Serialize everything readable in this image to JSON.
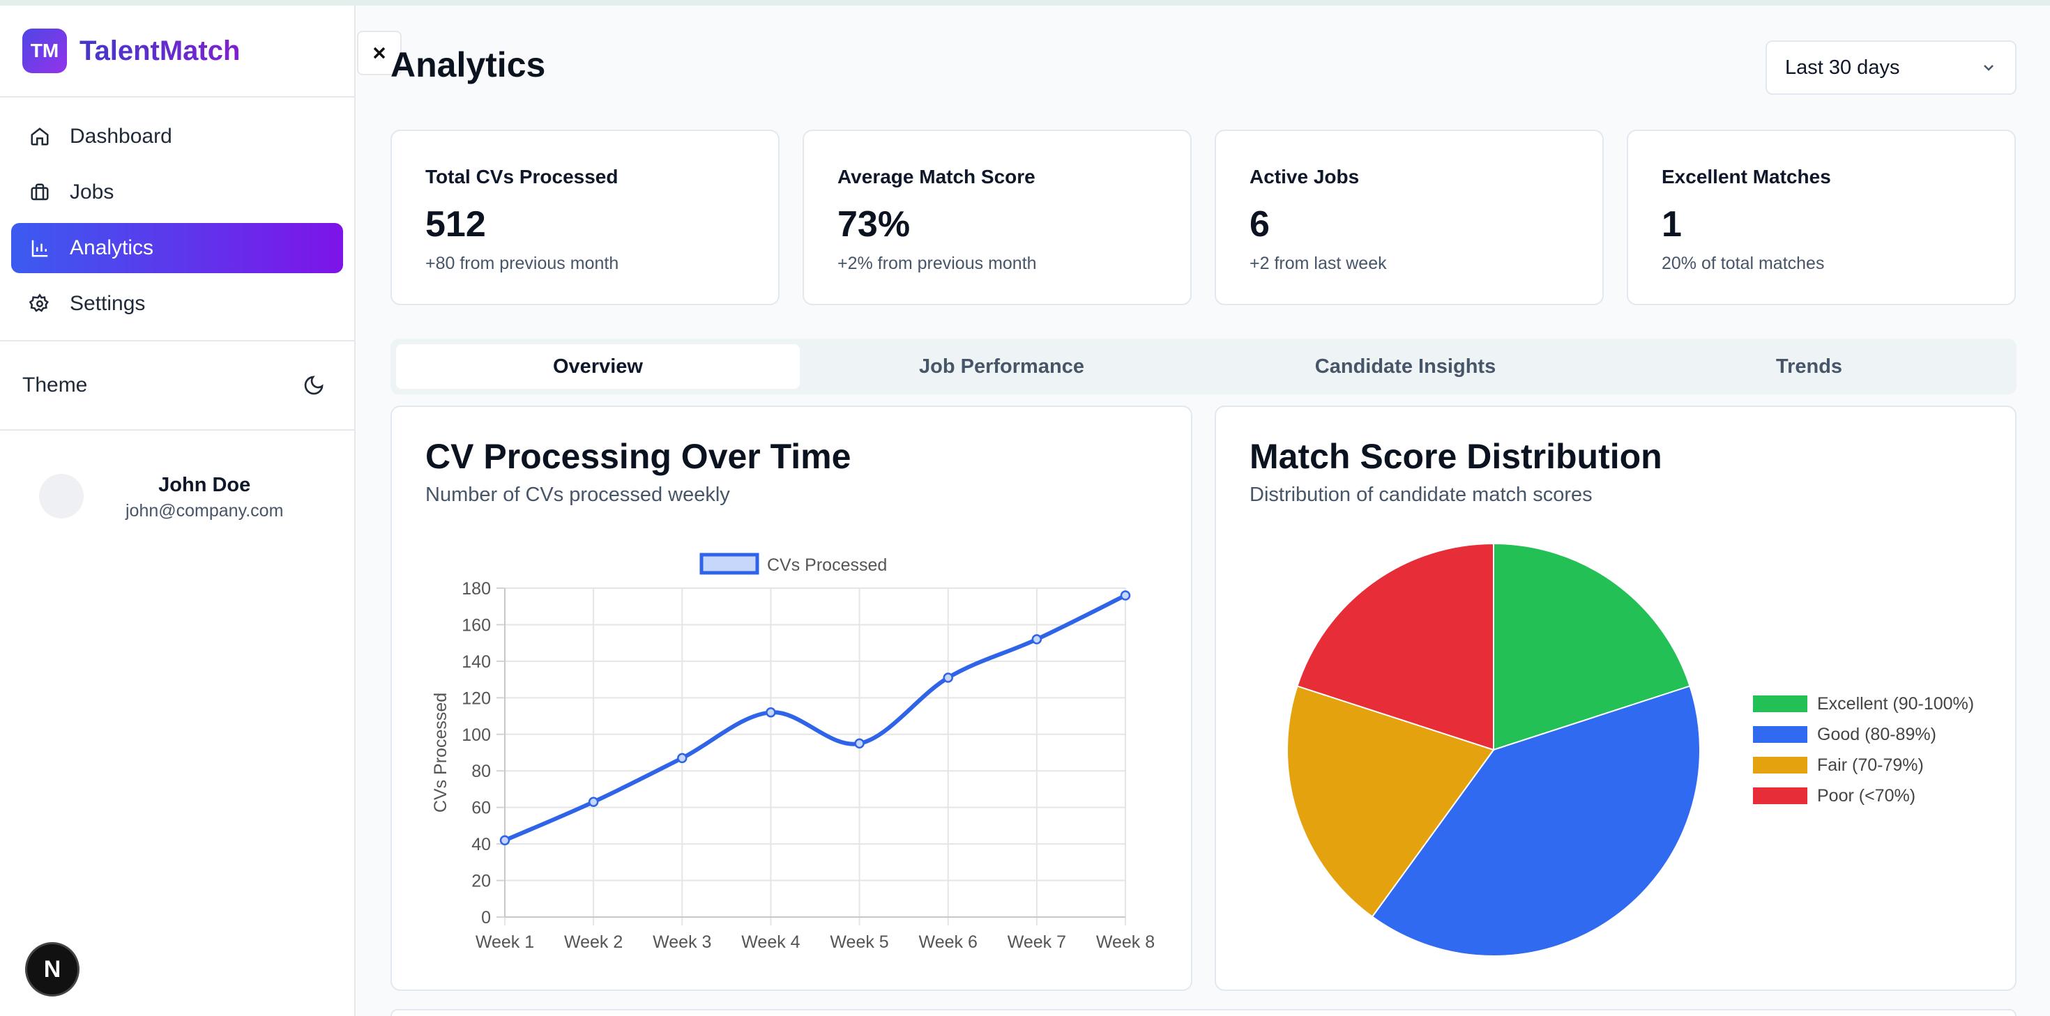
{
  "app": {
    "logo_initials": "TM",
    "name": "TalentMatch"
  },
  "sidebar": {
    "items": [
      {
        "label": "Dashboard",
        "icon": "home-icon"
      },
      {
        "label": "Jobs",
        "icon": "briefcase-icon"
      },
      {
        "label": "Analytics",
        "icon": "bar-chart-icon",
        "active": true
      },
      {
        "label": "Settings",
        "icon": "gear-icon"
      }
    ],
    "theme_label": "Theme",
    "user": {
      "name": "John Doe",
      "email": "john@company.com"
    },
    "badge": "N"
  },
  "header": {
    "title": "Analytics",
    "range_value": "Last 30 days"
  },
  "stats": [
    {
      "label": "Total CVs Processed",
      "value": "512",
      "sub": "+80 from previous month"
    },
    {
      "label": "Average Match Score",
      "value": "73%",
      "sub": "+2% from previous month"
    },
    {
      "label": "Active Jobs",
      "value": "6",
      "sub": "+2 from last week"
    },
    {
      "label": "Excellent Matches",
      "value": "1",
      "sub": "20% of total matches"
    }
  ],
  "tabs": [
    {
      "label": "Overview",
      "active": true
    },
    {
      "label": "Job Performance"
    },
    {
      "label": "Candidate Insights"
    },
    {
      "label": "Trends"
    }
  ],
  "colors": {
    "accent": "#3b5bf0",
    "accent2": "#7e14e8",
    "line": "#2f64e8"
  },
  "cards": {
    "line": {
      "title": "CV Processing Over Time",
      "subtitle": "Number of CVs processed weekly"
    },
    "pie": {
      "title": "Match Score Distribution",
      "subtitle": "Distribution of candidate match scores"
    }
  },
  "chart_data": [
    {
      "type": "line",
      "x": [
        "Week 1",
        "Week 2",
        "Week 3",
        "Week 4",
        "Week 5",
        "Week 6",
        "Week 7",
        "Week 8"
      ],
      "series": [
        {
          "name": "CVs Processed",
          "values": [
            42,
            63,
            87,
            112,
            95,
            131,
            152,
            176
          ]
        }
      ],
      "ylabel": "CVs Processed",
      "ylim": [
        0,
        180
      ],
      "yticks": [
        0,
        20,
        40,
        60,
        80,
        100,
        120,
        140,
        160,
        180
      ],
      "grid": true,
      "legend": "top"
    },
    {
      "type": "pie",
      "categories": [
        "Excellent (90-100%)",
        "Good (80-89%)",
        "Fair (70-79%)",
        "Poor (<70%)"
      ],
      "values": [
        20,
        40,
        20,
        20
      ],
      "colors": [
        "#22c055",
        "#2f6af0",
        "#e3a20e",
        "#e62d38"
      ],
      "legend": "right"
    }
  ]
}
